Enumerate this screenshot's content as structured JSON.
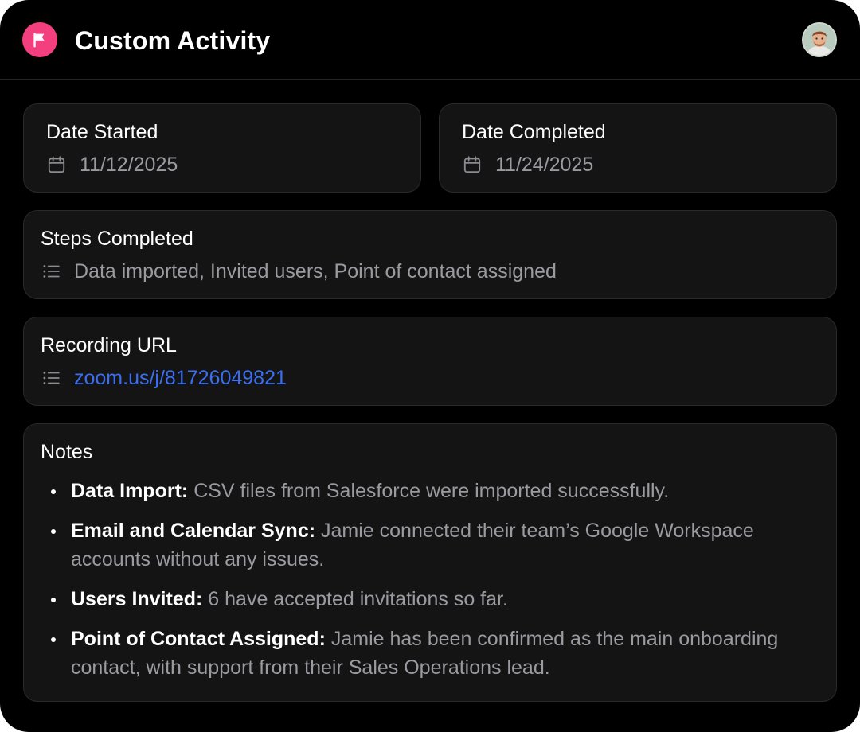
{
  "header": {
    "title": "Custom Activity",
    "icon": "flag-icon",
    "accent_color": "#f43f7f"
  },
  "fields": {
    "date_started": {
      "label": "Date Started",
      "value": "11/12/2025",
      "icon": "calendar-icon"
    },
    "date_completed": {
      "label": "Date Completed",
      "value": "11/24/2025",
      "icon": "calendar-icon"
    },
    "steps_completed": {
      "label": "Steps Completed",
      "value": "Data imported, Invited users, Point of contact assigned",
      "icon": "list-icon"
    },
    "recording_url": {
      "label": "Recording URL",
      "value": "zoom.us/j/81726049821",
      "icon": "list-icon",
      "link_color": "#3b6ef0"
    }
  },
  "notes": {
    "label": "Notes",
    "items": [
      {
        "heading": "Data Import:",
        "text": "CSV files from Salesforce were imported successfully."
      },
      {
        "heading": "Email and Calendar Sync:",
        "text": "Jamie connected their team’s Google Workspace accounts without any issues."
      },
      {
        "heading": "Users Invited:",
        "text": "6 have accepted invitations so far."
      },
      {
        "heading": "Point of Contact Assigned:",
        "text": "Jamie has been confirmed as the main onboarding contact, with support from their Sales Operations lead."
      }
    ]
  }
}
